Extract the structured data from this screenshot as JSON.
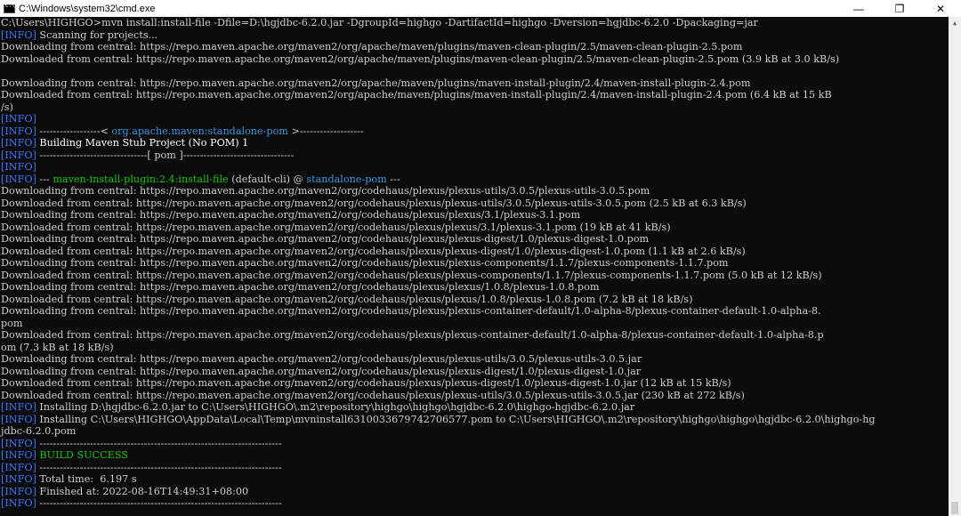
{
  "window": {
    "title": "C:\\Windows\\system32\\cmd.exe",
    "controls": {
      "minimize": "—",
      "restore": "❐",
      "close": "✕"
    }
  },
  "console": {
    "lines": [
      [
        [
          "t",
          "C:\\Users\\HIGHGO>mvn install:install-file -Dfile=D:\\hgjdbc-6.2.0.jar -DgroupId=highgo -DartifactId=highgo -Dversion=hgjdbc-6.2.0 -Dpackaging=jar"
        ]
      ],
      [
        [
          "b",
          "[INFO]"
        ],
        [
          "t",
          " Scanning for projects..."
        ]
      ],
      [
        [
          "t",
          "Downloading from central: https://repo.maven.apache.org/maven2/org/apache/maven/plugins/maven-clean-plugin/2.5/maven-clean-plugin-2.5.pom"
        ]
      ],
      [
        [
          "t",
          "Downloaded from central: https://repo.maven.apache.org/maven2/org/apache/maven/plugins/maven-clean-plugin/2.5/maven-clean-plugin-2.5.pom (3.9 kB at 3.0 kB/s)"
        ]
      ],
      [
        [
          "t",
          ""
        ]
      ],
      [
        [
          "t",
          "Downloading from central: https://repo.maven.apache.org/maven2/org/apache/maven/plugins/maven-install-plugin/2.4/maven-install-plugin-2.4.pom"
        ]
      ],
      [
        [
          "t",
          "Downloaded from central: https://repo.maven.apache.org/maven2/org/apache/maven/plugins/maven-install-plugin/2.4/maven-install-plugin-2.4.pom (6.4 kB at 15 kB"
        ]
      ],
      [
        [
          "t",
          "/s)"
        ]
      ],
      [
        [
          "b",
          "[INFO]"
        ]
      ],
      [
        [
          "b",
          "[INFO]"
        ],
        [
          "t",
          " ------------------< "
        ],
        [
          "c",
          "org.apache.maven:standalone-pom"
        ],
        [
          "t",
          " >-------------------"
        ]
      ],
      [
        [
          "b",
          "[INFO]"
        ],
        [
          "w",
          " Building Maven Stub Project (No POM) 1"
        ]
      ],
      [
        [
          "b",
          "[INFO]"
        ],
        [
          "t",
          " --------------------------------[ pom ]---------------------------------"
        ]
      ],
      [
        [
          "b",
          "[INFO]"
        ]
      ],
      [
        [
          "b",
          "[INFO]"
        ],
        [
          "t",
          " --- "
        ],
        [
          "g",
          "maven-install-plugin:2.4:install-file"
        ],
        [
          "t",
          " (default-cli) @ "
        ],
        [
          "c",
          "standalone-pom"
        ],
        [
          "t",
          " ---"
        ]
      ],
      [
        [
          "t",
          "Downloading from central: https://repo.maven.apache.org/maven2/org/codehaus/plexus/plexus-utils/3.0.5/plexus-utils-3.0.5.pom"
        ]
      ],
      [
        [
          "t",
          "Downloaded from central: https://repo.maven.apache.org/maven2/org/codehaus/plexus/plexus-utils/3.0.5/plexus-utils-3.0.5.pom (2.5 kB at 6.3 kB/s)"
        ]
      ],
      [
        [
          "t",
          "Downloading from central: https://repo.maven.apache.org/maven2/org/codehaus/plexus/plexus/3.1/plexus-3.1.pom"
        ]
      ],
      [
        [
          "t",
          "Downloaded from central: https://repo.maven.apache.org/maven2/org/codehaus/plexus/plexus/3.1/plexus-3.1.pom (19 kB at 41 kB/s)"
        ]
      ],
      [
        [
          "t",
          "Downloading from central: https://repo.maven.apache.org/maven2/org/codehaus/plexus/plexus-digest/1.0/plexus-digest-1.0.pom"
        ]
      ],
      [
        [
          "t",
          "Downloaded from central: https://repo.maven.apache.org/maven2/org/codehaus/plexus/plexus-digest/1.0/plexus-digest-1.0.pom (1.1 kB at 2.6 kB/s)"
        ]
      ],
      [
        [
          "t",
          "Downloading from central: https://repo.maven.apache.org/maven2/org/codehaus/plexus/plexus-components/1.1.7/plexus-components-1.1.7.pom"
        ]
      ],
      [
        [
          "t",
          "Downloaded from central: https://repo.maven.apache.org/maven2/org/codehaus/plexus/plexus-components/1.1.7/plexus-components-1.1.7.pom (5.0 kB at 12 kB/s)"
        ]
      ],
      [
        [
          "t",
          "Downloading from central: https://repo.maven.apache.org/maven2/org/codehaus/plexus/plexus/1.0.8/plexus-1.0.8.pom"
        ]
      ],
      [
        [
          "t",
          "Downloaded from central: https://repo.maven.apache.org/maven2/org/codehaus/plexus/plexus/1.0.8/plexus-1.0.8.pom (7.2 kB at 18 kB/s)"
        ]
      ],
      [
        [
          "t",
          "Downloading from central: https://repo.maven.apache.org/maven2/org/codehaus/plexus/plexus-container-default/1.0-alpha-8/plexus-container-default-1.0-alpha-8."
        ]
      ],
      [
        [
          "t",
          "pom"
        ]
      ],
      [
        [
          "t",
          "Downloaded from central: https://repo.maven.apache.org/maven2/org/codehaus/plexus/plexus-container-default/1.0-alpha-8/plexus-container-default-1.0-alpha-8.p"
        ]
      ],
      [
        [
          "t",
          "om (7.3 kB at 18 kB/s)"
        ]
      ],
      [
        [
          "t",
          "Downloading from central: https://repo.maven.apache.org/maven2/org/codehaus/plexus/plexus-utils/3.0.5/plexus-utils-3.0.5.jar"
        ]
      ],
      [
        [
          "t",
          "Downloading from central: https://repo.maven.apache.org/maven2/org/codehaus/plexus/plexus-digest/1.0/plexus-digest-1.0.jar"
        ]
      ],
      [
        [
          "t",
          "Downloaded from central: https://repo.maven.apache.org/maven2/org/codehaus/plexus/plexus-digest/1.0/plexus-digest-1.0.jar (12 kB at 15 kB/s)"
        ]
      ],
      [
        [
          "t",
          "Downloaded from central: https://repo.maven.apache.org/maven2/org/codehaus/plexus/plexus-utils/3.0.5/plexus-utils-3.0.5.jar (230 kB at 272 kB/s)"
        ]
      ],
      [
        [
          "b",
          "[INFO]"
        ],
        [
          "t",
          " Installing D:\\hgjdbc-6.2.0.jar to C:\\Users\\HIGHGO\\.m2\\repository\\highgo\\highgo\\hgjdbc-6.2.0\\highgo-hgjdbc-6.2.0.jar"
        ]
      ],
      [
        [
          "b",
          "[INFO]"
        ],
        [
          "t",
          " Installing C:\\Users\\HIGHGO\\AppData\\Local\\Temp\\mvninstall6310033679742706577.pom to C:\\Users\\HIGHGO\\.m2\\repository\\highgo\\highgo\\hgjdbc-6.2.0\\highgo-hg"
        ]
      ],
      [
        [
          "t",
          "jdbc-6.2.0.pom"
        ]
      ],
      [
        [
          "b",
          "[INFO]"
        ],
        [
          "t",
          " ------------------------------------------------------------------------"
        ]
      ],
      [
        [
          "b",
          "[INFO]"
        ],
        [
          "g",
          " BUILD SUCCESS"
        ]
      ],
      [
        [
          "b",
          "[INFO]"
        ],
        [
          "t",
          " ------------------------------------------------------------------------"
        ]
      ],
      [
        [
          "b",
          "[INFO]"
        ],
        [
          "t",
          " Total time:  6.197 s"
        ]
      ],
      [
        [
          "b",
          "[INFO]"
        ],
        [
          "t",
          " Finished at: 2022-08-16T14:49:31+08:00"
        ]
      ],
      [
        [
          "b",
          "[INFO]"
        ],
        [
          "t",
          " ------------------------------------------------------------------------"
        ]
      ]
    ]
  },
  "colors": {
    "background": "#0c0c0c",
    "text": "#cccccc",
    "info_blue": "#3b78ff",
    "success_green": "#16c60c",
    "artifact_cyan": "#3a96dd"
  },
  "icons": {
    "app": "cmd-icon",
    "scroll_up": "scroll-up-arrow-icon"
  }
}
